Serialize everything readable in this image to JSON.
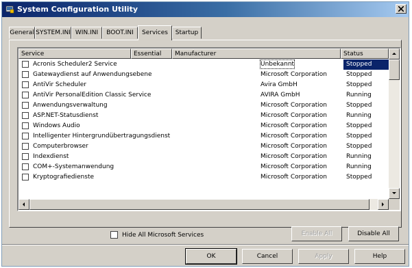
{
  "window": {
    "title": "System Configuration Utility"
  },
  "tabs": [
    {
      "label": "General"
    },
    {
      "label": "SYSTEM.INI"
    },
    {
      "label": "WIN.INI"
    },
    {
      "label": "BOOT.INI"
    },
    {
      "label": "Services"
    },
    {
      "label": "Startup"
    }
  ],
  "active_tab": "Services",
  "list": {
    "columns": [
      "Service",
      "Essential",
      "Manufacturer",
      "Status"
    ],
    "rows": [
      {
        "name": "Acronis Scheduler2 Service",
        "essential": "",
        "manufacturer": "Unbekannt",
        "status": "Stopped",
        "checked": false,
        "selected": true
      },
      {
        "name": "Gatewaydienst auf Anwendungsebene",
        "essential": "",
        "manufacturer": "Microsoft Corporation",
        "status": "Stopped",
        "checked": false,
        "selected": false
      },
      {
        "name": "AntiVir Scheduler",
        "essential": "",
        "manufacturer": "Avira GmbH",
        "status": "Stopped",
        "checked": false,
        "selected": false
      },
      {
        "name": "AntiVir PersonalEdition Classic Service",
        "essential": "",
        "manufacturer": "AVIRA GmbH",
        "status": "Running",
        "checked": false,
        "selected": false
      },
      {
        "name": "Anwendungsverwaltung",
        "essential": "",
        "manufacturer": "Microsoft Corporation",
        "status": "Stopped",
        "checked": false,
        "selected": false
      },
      {
        "name": "ASP.NET-Statusdienst",
        "essential": "",
        "manufacturer": "Microsoft Corporation",
        "status": "Running",
        "checked": false,
        "selected": false
      },
      {
        "name": "Windows Audio",
        "essential": "",
        "manufacturer": "Microsoft Corporation",
        "status": "Stopped",
        "checked": false,
        "selected": false
      },
      {
        "name": "Intelligenter Hintergrundübertragungsdienst",
        "essential": "",
        "manufacturer": "Microsoft Corporation",
        "status": "Stopped",
        "checked": false,
        "selected": false
      },
      {
        "name": "Computerbrowser",
        "essential": "",
        "manufacturer": "Microsoft Corporation",
        "status": "Stopped",
        "checked": false,
        "selected": false
      },
      {
        "name": "Indexdienst",
        "essential": "",
        "manufacturer": "Microsoft Corporation",
        "status": "Running",
        "checked": false,
        "selected": false
      },
      {
        "name": "COM+-Systemanwendung",
        "essential": "",
        "manufacturer": "Microsoft Corporation",
        "status": "Running",
        "checked": false,
        "selected": false
      },
      {
        "name": "Kryptografiedienste",
        "essential": "",
        "manufacturer": "Microsoft Corporation",
        "status": "Stopped",
        "checked": false,
        "selected": false
      }
    ]
  },
  "hide_ms": {
    "label": "Hide All Microsoft Services",
    "checked": false
  },
  "buttons": {
    "enable_all": "Enable All",
    "disable_all": "Disable All",
    "ok": "OK",
    "cancel": "Cancel",
    "apply": "Apply",
    "help": "Help"
  },
  "colors": {
    "titlebar": "#0a246a",
    "selection": "#0a246a",
    "face": "#d4d0c8"
  },
  "icons": {
    "app": "msconfig-icon",
    "close": "close-icon"
  }
}
